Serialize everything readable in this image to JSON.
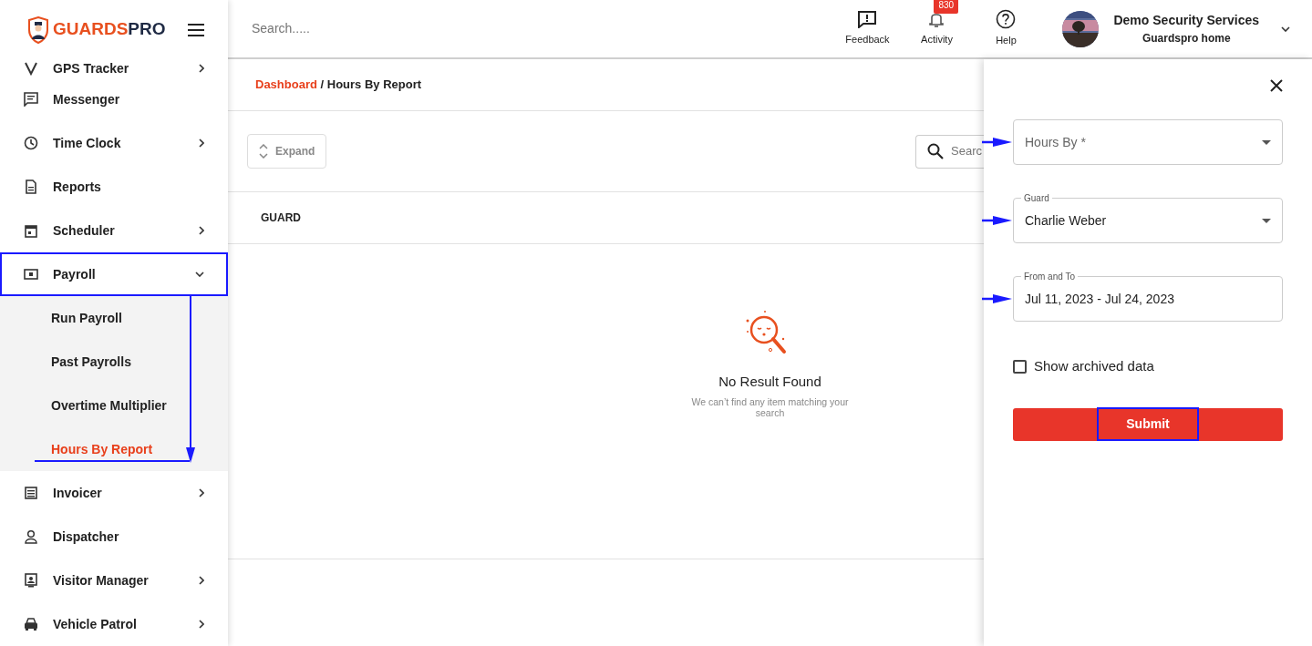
{
  "brand": {
    "name_first": "GUARDS",
    "name_second": "PRO"
  },
  "sidebar": {
    "items": [
      {
        "label": "GPS Tracker",
        "has_submenu": true,
        "expanded": false,
        "annotated": false
      },
      {
        "label": "Messenger",
        "has_submenu": false,
        "annotated": false
      },
      {
        "label": "Time Clock",
        "has_submenu": true,
        "expanded": false,
        "annotated": false
      },
      {
        "label": "Reports",
        "has_submenu": false,
        "annotated": false
      },
      {
        "label": "Scheduler",
        "has_submenu": true,
        "expanded": false,
        "annotated": false
      },
      {
        "label": "Payroll",
        "has_submenu": true,
        "expanded": true,
        "annotated": true,
        "children": [
          {
            "label": "Run Payroll",
            "selected": false,
            "annotated": false
          },
          {
            "label": "Past Payrolls",
            "selected": false,
            "annotated": false
          },
          {
            "label": "Overtime Multiplier",
            "selected": false,
            "annotated": false
          },
          {
            "label": "Hours By Report",
            "selected": true,
            "annotated": true
          }
        ]
      },
      {
        "label": "Invoicer",
        "has_submenu": true,
        "expanded": false,
        "annotated": false
      },
      {
        "label": "Dispatcher",
        "has_submenu": false,
        "annotated": false
      },
      {
        "label": "Visitor Manager",
        "has_submenu": true,
        "expanded": false,
        "annotated": false
      },
      {
        "label": "Vehicle Patrol",
        "has_submenu": true,
        "expanded": false,
        "annotated": false
      }
    ]
  },
  "header": {
    "search": {
      "placeholder": "Search....."
    },
    "actions": [
      {
        "label": "Feedback"
      },
      {
        "label": "Activity",
        "badge": "830"
      },
      {
        "label": "Help"
      }
    ],
    "account": {
      "name": "Demo Security Services",
      "subtitle": "Guardspro home"
    }
  },
  "breadcrumb": {
    "link": "Dashboard",
    "separator": "/",
    "current": "Hours By Report"
  },
  "toolbar": {
    "expand_button": "Expand",
    "search": {
      "placeholder": "Searc"
    }
  },
  "table": {
    "columns": [
      "GUARD"
    ]
  },
  "empty_state": {
    "title": "No Result Found",
    "message": "We can’t find any item matching your search"
  },
  "filter_panel": {
    "fields": [
      {
        "kind": "select",
        "placeholder": "Hours By *",
        "arrow": true
      },
      {
        "kind": "select",
        "label": "Guard",
        "value": "Charlie Weber",
        "arrow": true
      },
      {
        "kind": "date",
        "label": "From and To",
        "value": "Jul 11, 2023 - Jul 24, 2023",
        "arrow": true
      }
    ],
    "checkbox": {
      "label": "Show archived data",
      "checked": false
    },
    "submit": {
      "label": "Submit",
      "annotated": true
    }
  }
}
